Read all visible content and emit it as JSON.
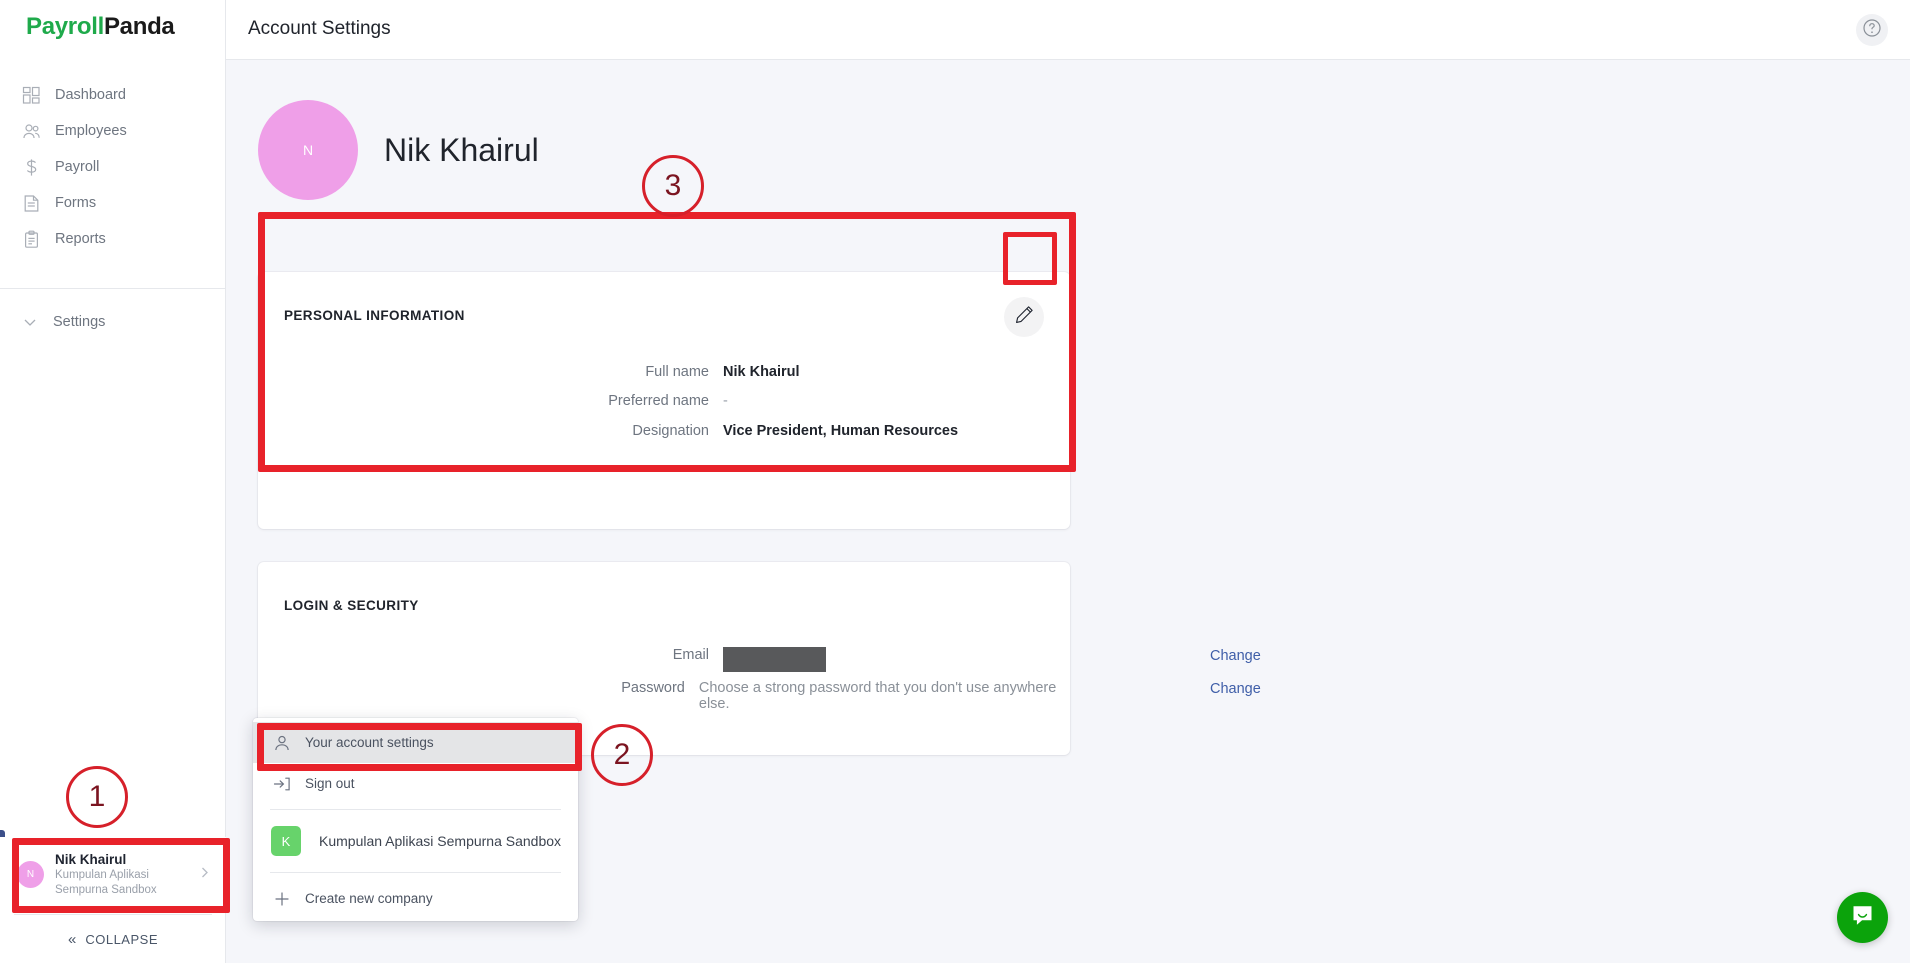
{
  "brand": {
    "part1": "Payroll",
    "part2": "Panda",
    "green": "#1faa4b"
  },
  "header": {
    "title": "Account Settings",
    "help_icon": "help-circle-icon"
  },
  "sidebar": {
    "items": [
      {
        "label": "Dashboard",
        "icon": "dashboard-grid-icon"
      },
      {
        "label": "Employees",
        "icon": "people-icon"
      },
      {
        "label": "Payroll",
        "icon": "dollar-icon"
      },
      {
        "label": "Forms",
        "icon": "document-icon"
      },
      {
        "label": "Reports",
        "icon": "clipboard-icon"
      }
    ],
    "settings": {
      "label": "Settings",
      "icon": "chevron-down-icon"
    },
    "user": {
      "initial": "N",
      "name": "Nik Khairul",
      "company_line1": "Kumpulan Aplikasi",
      "company_line2": "Sempurna Sandbox",
      "chevron": "chevron-right-icon"
    },
    "collapse": {
      "label": "COLLAPSE",
      "icon": "double-chevron-left-icon"
    }
  },
  "profile": {
    "avatar_initial": "N",
    "name": "Nik Khairul"
  },
  "personal_information": {
    "title": "PERSONAL INFORMATION",
    "edit_icon": "pencil-icon",
    "fields": [
      {
        "label": "Full name",
        "value": "Nik Khairul",
        "style": "bold"
      },
      {
        "label": "Preferred name",
        "value": "-",
        "style": "muted"
      },
      {
        "label": "Designation",
        "value": "Vice President, Human Resources",
        "style": "bold"
      }
    ]
  },
  "login_security": {
    "title": "LOGIN & SECURITY",
    "rows": [
      {
        "label": "Email",
        "value": "",
        "redacted": true,
        "action": "Change"
      },
      {
        "label": "Password",
        "value": "Choose a strong password that you don't use anywhere else.",
        "redacted": false,
        "action": "Change"
      }
    ]
  },
  "account_menu": {
    "items": [
      {
        "label": "Your account settings",
        "icon": "user-outline-icon",
        "active": true
      },
      {
        "label": "Sign out",
        "icon": "sign-out-icon",
        "active": false
      }
    ],
    "company": {
      "badge": "K",
      "label": "Kumpulan Aplikasi Sempurna Sandbox",
      "badge_color": "#67d36b"
    },
    "create": {
      "label": "Create new company",
      "icon": "plus-icon"
    }
  },
  "annotations": {
    "marker_color": "#e8222a",
    "markers": [
      {
        "number": "1",
        "target": "sidebar-user-card"
      },
      {
        "number": "2",
        "target": "account-menu-your-account-settings"
      },
      {
        "number": "3",
        "target": "personal-information-card"
      }
    ]
  },
  "support": {
    "icon": "chat-bubble-icon",
    "color": "#0ba30b"
  }
}
